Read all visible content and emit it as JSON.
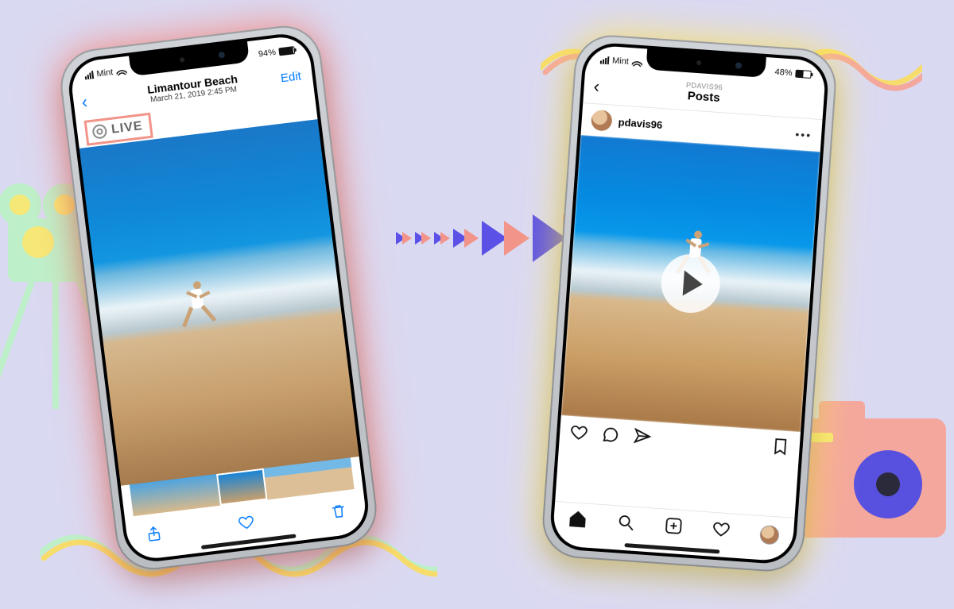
{
  "left": {
    "status": {
      "carrier": "Mint",
      "battery_pct": "94%",
      "battery_fill": "94%"
    },
    "nav": {
      "album_title": "Limantour Beach",
      "subtitle": "March 21, 2019  2:45 PM",
      "edit_label": "Edit"
    },
    "live_badge": "LIVE"
  },
  "right": {
    "status": {
      "carrier": "Mint",
      "battery_pct": "48%",
      "battery_fill": "48%"
    },
    "nav": {
      "subtitle": "PDAVIS96",
      "title": "Posts"
    },
    "post": {
      "username": "pdavis96"
    }
  }
}
